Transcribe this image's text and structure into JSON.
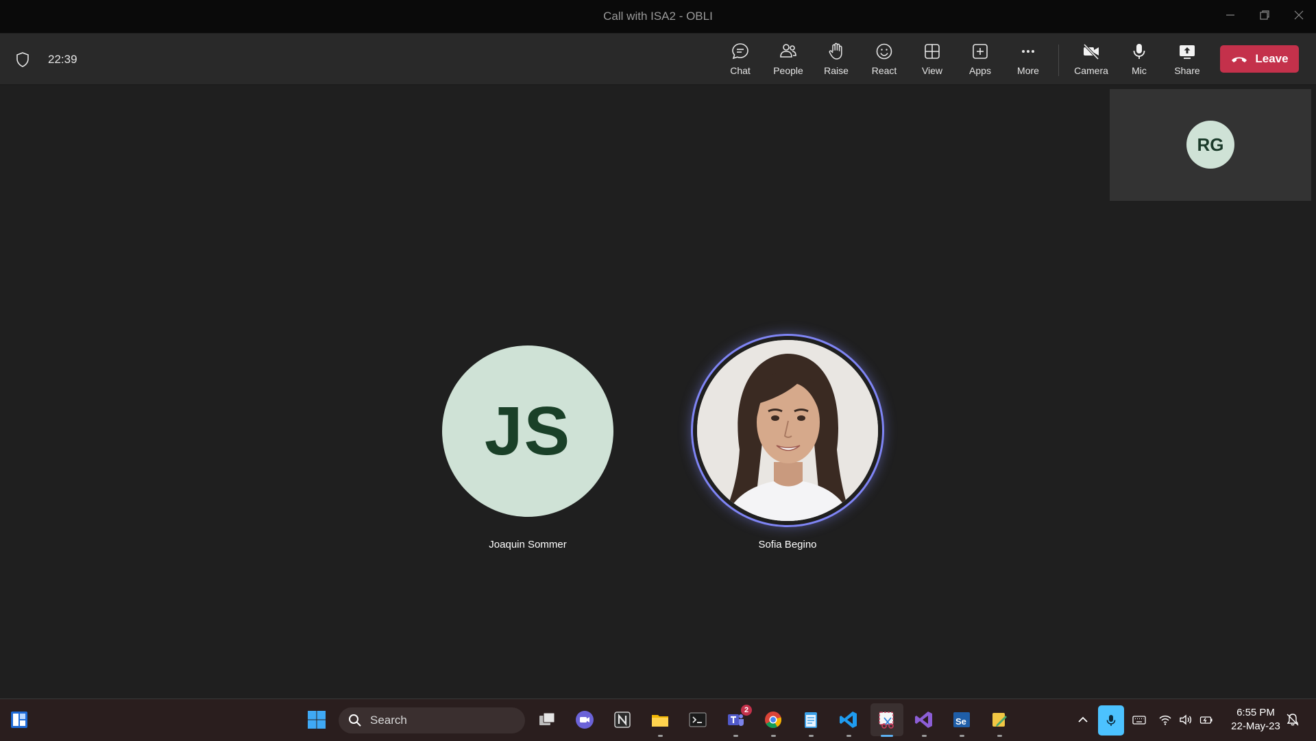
{
  "window": {
    "title": "Call with ISA2 - OBLI"
  },
  "toolbar": {
    "timer": "22:39",
    "buttons": {
      "chat": "Chat",
      "people": "People",
      "raise": "Raise",
      "react": "React",
      "view": "View",
      "apps": "Apps",
      "more": "More",
      "camera": "Camera",
      "mic": "Mic",
      "share": "Share"
    },
    "leave": "Leave",
    "leave_color": "#c4314b"
  },
  "self_preview": {
    "initials": "RG"
  },
  "participants": [
    {
      "initials": "JS",
      "name": "Joaquin Sommer"
    },
    {
      "initials": "",
      "name": "Sofia Begino",
      "speaking": true,
      "ring_color": "#7f85f5"
    }
  ],
  "taskbar": {
    "search_label": "Search",
    "teams_badge": "2",
    "clock_time": "6:55 PM",
    "clock_date": "22-May-23"
  }
}
